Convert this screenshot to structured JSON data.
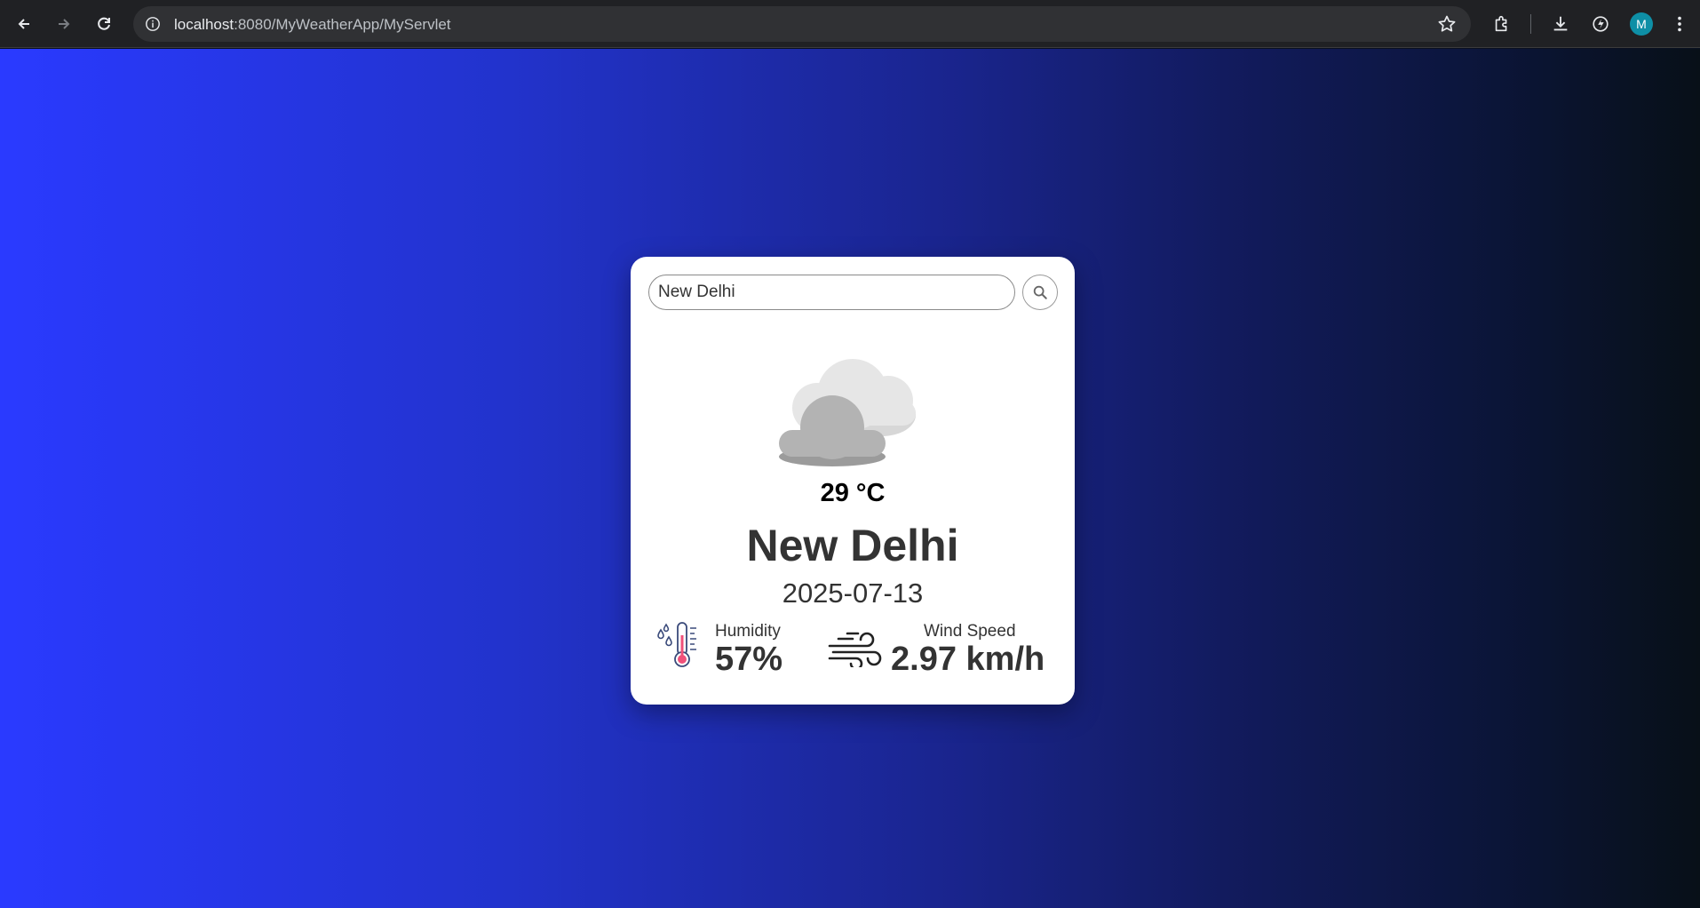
{
  "browser": {
    "url_host": "localhost",
    "url_rest": ":8080/MyWeatherApp/MyServlet",
    "avatar_letter": "M",
    "avatar_color": "#0e8fa6"
  },
  "search": {
    "value": "New Delhi"
  },
  "weather": {
    "condition_icon": "clouds-icon",
    "temperature": "29 °C",
    "city": "New Delhi",
    "date": "2025-07-13",
    "humidity_label": "Humidity",
    "humidity_value": "57%",
    "wind_label": "Wind Speed",
    "wind_value": "2.97 km/h"
  },
  "colors": {
    "gradient_start": "#2a3aff",
    "gradient_end": "#081018",
    "card_bg": "#ffffff",
    "text_dark": "#333333"
  }
}
